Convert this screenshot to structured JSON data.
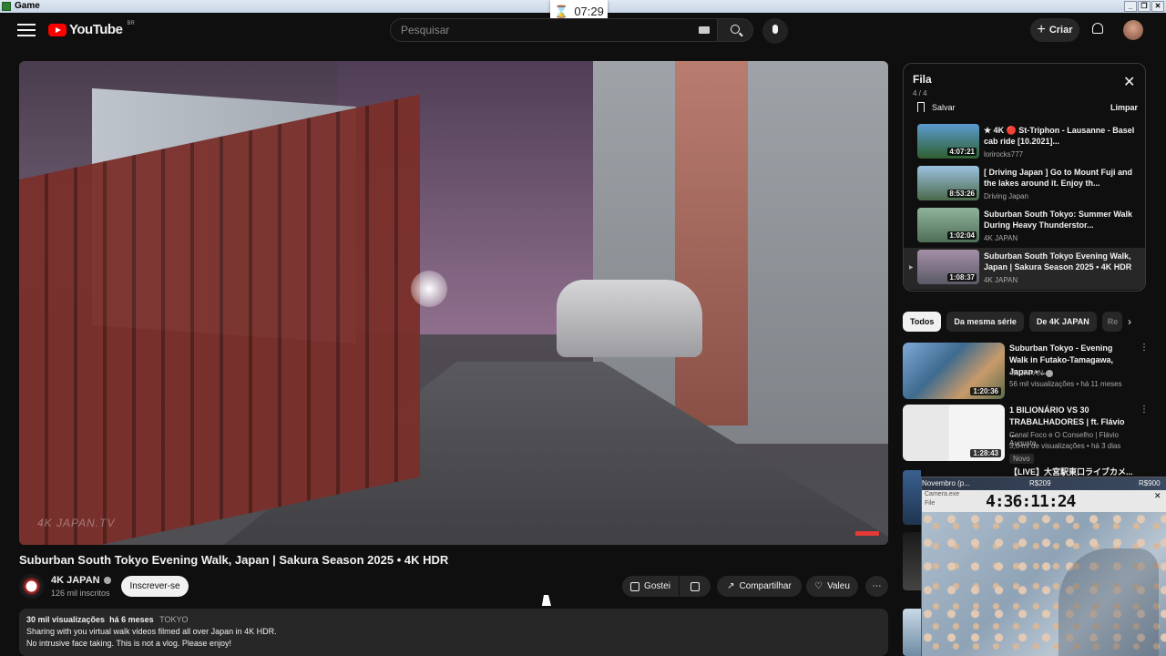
{
  "window": {
    "title": "Game"
  },
  "timer": {
    "value": "07:29"
  },
  "masthead": {
    "logo_text": "YouTube",
    "region": "BR",
    "search_placeholder": "Pesquisar",
    "create_label": "Criar"
  },
  "video": {
    "title": "Suburban South Tokyo Evening Walk, Japan | Sakura Season 2025 • 4K HDR",
    "watermark": "4K JAPAN.TV",
    "channel": {
      "name": "4K JAPAN",
      "subs": "126 mil inscritos",
      "subscribe_label": "Inscrever-se"
    },
    "actions": {
      "like": "Gostei",
      "share": "Compartilhar",
      "thanks": "Valeu"
    },
    "description": {
      "views": "30 mil visualizações",
      "age": "há 6 meses",
      "tag": "TOKYO",
      "line1": "Sharing with you virtual walk videos filmed all over Japan in 4K HDR.",
      "line2": "No intrusive face taking. This is not a vlog. Please enjoy!"
    }
  },
  "queue": {
    "title": "Fila",
    "count": "4 / 4",
    "save_label": "Salvar",
    "clear_label": "Limpar",
    "items": [
      {
        "title": "★ 4K 🔴 St-Triphon - Lausanne - Basel cab ride [10.2021]...",
        "channel": "lorirocks777",
        "duration": "4:07:21",
        "color": "#3f7fb5"
      },
      {
        "title": "[ Driving Japan ] Go to Mount Fuji and the lakes around it. Enjoy th...",
        "channel": "Driving Japan",
        "duration": "8:53:26",
        "color": "#7aa3c9"
      },
      {
        "title": "Suburban South Tokyo: Summer Walk During Heavy Thunderstor...",
        "channel": "4K JAPAN",
        "duration": "1:02:04",
        "color": "#6f9a6a"
      },
      {
        "title": "Suburban South Tokyo Evening Walk, Japan | Sakura Season 2025 • 4K HDR",
        "channel": "4K JAPAN",
        "duration": "1:08:37",
        "color": "#8a7f92",
        "active": true
      }
    ]
  },
  "chips": [
    "Todos",
    "Da mesma série",
    "De 4K JAPAN",
    "Re"
  ],
  "recommendations": [
    {
      "title": "Suburban Tokyo - Evening Walk in Futako-Tamagawa, Japan • ...",
      "channel": "4K JAPAN",
      "views": "56 mil visualizações • há 11 meses",
      "duration": "1:20:36",
      "badge": ""
    },
    {
      "title": "1 BILIONÁRIO VS 30 TRABALHADORES | ft. Flávio ...",
      "channel": "Canal Foco e O Conselho | Flávio Augusto",
      "views": "3,6 mi de visualizações • há 3 dias",
      "duration": "1:28:43",
      "badge": "Novo"
    },
    {
      "title": "【LIVE】大宮駅東口ライブカメ...",
      "channel": "",
      "views": "",
      "duration": "",
      "badge": ""
    }
  ],
  "overlay": {
    "header_left": "Novembro (p...",
    "header_mid": "R$209",
    "header_right": "R$900",
    "app_name": "Camera.exe",
    "menu": "File",
    "clock": "4:36:11:24"
  }
}
